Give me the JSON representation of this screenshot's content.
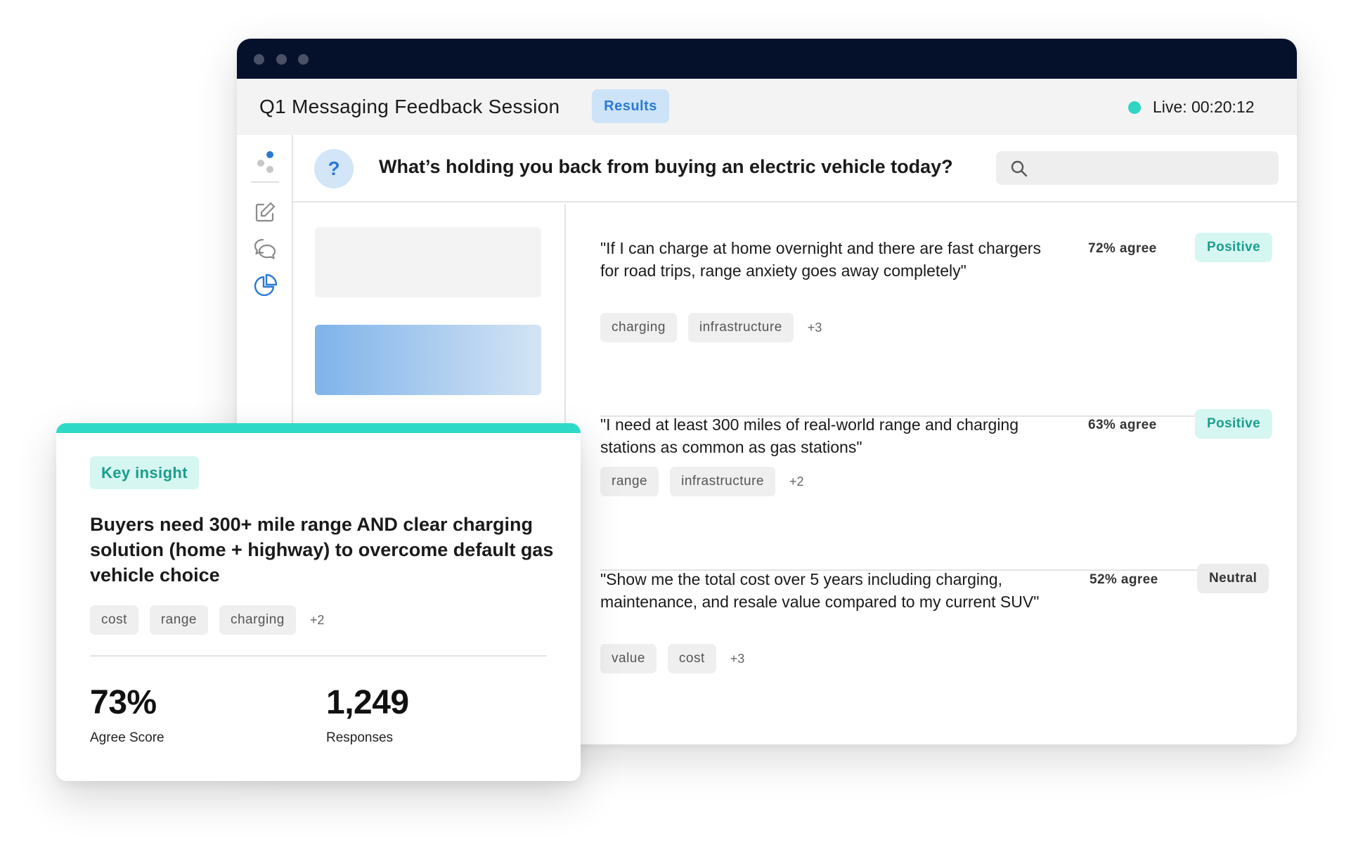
{
  "window": {
    "session_title": "Q1 Messaging Feedback Session",
    "results_label": "Results",
    "live_label": "Live: 00:20:12",
    "live_color": "#2fd6c4"
  },
  "sidebar": {
    "icons": [
      "logo-icon",
      "edit-icon",
      "chat-bubbles-icon",
      "pie-chart-icon"
    ],
    "active": "pie-chart-icon"
  },
  "question": {
    "icon_text": "?",
    "text": "What’s holding you back from buying an electric vehicle today?",
    "search_placeholder": ""
  },
  "responses": [
    {
      "quote": "\"If I can charge at home overnight and there are fast chargers for road trips, range anxiety goes away completely\"",
      "agree": "72% agree",
      "sentiment": "Positive",
      "tags": [
        "charging",
        "infrastructure"
      ],
      "more": "+3"
    },
    {
      "quote": "\"I need at least 300 miles of real-world range and charging stations as common as gas stations\"",
      "agree": "63% agree",
      "sentiment": "Positive",
      "tags": [
        "range",
        "infrastructure"
      ],
      "more": "+2"
    },
    {
      "quote": "\"Show me the total cost over 5 years including charging, maintenance, and resale value compared to my current SUV\"",
      "agree": "52% agree",
      "sentiment": "Neutral",
      "tags": [
        "value",
        "cost"
      ],
      "more": "+3"
    }
  ],
  "insight": {
    "badge": "Key insight",
    "title": "Buyers need 300+ mile range AND clear charging solution (home + highway) to overcome default gas vehicle choice",
    "tags": [
      "cost",
      "range",
      "charging"
    ],
    "more": "+2",
    "stats": [
      {
        "value": "73%",
        "label": "Agree Score"
      },
      {
        "value": "1,249",
        "label": "Responses"
      }
    ],
    "accent_color": "#2fd9c8"
  }
}
